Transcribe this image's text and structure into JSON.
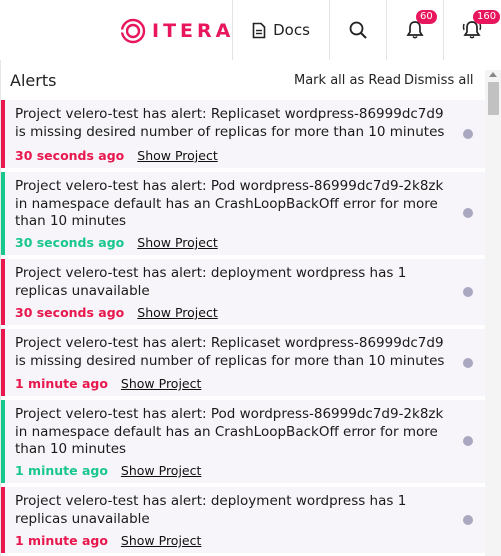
{
  "brand": {
    "name": "ITERA",
    "color": "#e8175d"
  },
  "topbar": {
    "docs_label": "Docs",
    "notifications_badge": "60",
    "alerts_badge": "160"
  },
  "panel": {
    "title": "Alerts",
    "mark_all_read": "Mark all as Read",
    "dismiss_all": "Dismiss all"
  },
  "alerts": [
    {
      "message": "Project velero-test has alert: Replicaset wordpress-86999dc7d9 is missing desired number of replicas for more than 10 minutes",
      "time": "30 seconds ago",
      "link": "Show Project",
      "severity": "red"
    },
    {
      "message": "Project velero-test has alert: Pod wordpress-86999dc7d9-2k8zk in namespace default has an CrashLoopBackOff error for more than 10 minutes",
      "time": "30 seconds ago",
      "link": "Show Project",
      "severity": "green"
    },
    {
      "message": "Project velero-test has alert: deployment wordpress has 1 replicas unavailable",
      "time": "30 seconds ago",
      "link": "Show Project",
      "severity": "red"
    },
    {
      "message": "Project velero-test has alert: Replicaset wordpress-86999dc7d9 is missing desired number of replicas for more than 10 minutes",
      "time": "1 minute ago",
      "link": "Show Project",
      "severity": "red"
    },
    {
      "message": "Project velero-test has alert: Pod wordpress-86999dc7d9-2k8zk in namespace default has an CrashLoopBackOff error for more than 10 minutes",
      "time": "1 minute ago",
      "link": "Show Project",
      "severity": "green"
    },
    {
      "message": "Project velero-test has alert: deployment wordpress has 1 replicas unavailable",
      "time": "1 minute ago",
      "link": "Show Project",
      "severity": "red"
    }
  ],
  "colors": {
    "red": "#e8174d",
    "green": "#19c78d",
    "dot": "#a9a8c0"
  },
  "icons": [
    "itera-logo-icon",
    "document-icon",
    "search-icon",
    "bell-icon",
    "alert-bell-icon",
    "unread-dot-icon"
  ]
}
